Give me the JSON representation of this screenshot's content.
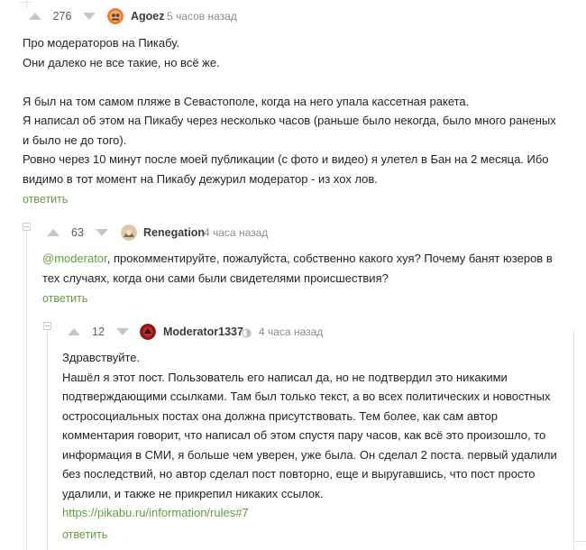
{
  "comments": [
    {
      "rating": "276",
      "author": "Agoez",
      "time": "5 часов назад",
      "lines": [
        "Про модераторов на Пикабу.",
        "Они далеко не все такие, но всё же.",
        "",
        "Я был на том самом пляже в Севастополе, когда на него упала кассетная ракета.",
        "Я написал об этом на Пикабу через несколько часов (раньше было некогда, было много раненых",
        "и было не до того).",
        "Ровно через 10 минут после моей публикации (с фото и видео) я улетел в Бан на 2 месяца. Ибо",
        "видимо в тот момент на Пикабу дежурил модератор - из хох лов."
      ],
      "reply_label": "ответить"
    },
    {
      "rating": "63",
      "author": "Renegation",
      "time": "4 часа назад",
      "mention": "@moderator",
      "line1_rest": ", прокомментируйте, пожалуйста, собственно какого хуя? Почему банят юзеров в",
      "line2": "тех случаях, когда они сами были свидетелями происшествия?",
      "reply_label": "ответить"
    },
    {
      "rating": "12",
      "author": "Moderator1337",
      "time": "4 часа назад",
      "lines": [
        "Здравствуйте.",
        "Нашёл я этот пост. Пользователь его написал да, но не подтвердил это никакими",
        "подтверждающими ссылками. Там был только текст, а во всех политических и новостных",
        "остросоциальных постах она должна присутствовать. Тем более, как сам автор",
        "комментария говорит, что написал об этом спустя пару часов, как всё это произошло, то",
        "информация в СМИ, я больше чем уверен, уже была. Он сделал 2 поста. первый удалили",
        "без последствий, но автор сделал пост повторно, еще и выругавшись, что пост просто",
        "удалили, и также не прикрепил никаких ссылок."
      ],
      "link": "https://pikabu.ru/information/rules#7",
      "reply_label": "ответить"
    }
  ],
  "colors": {
    "accent_green": "#5f9e3f",
    "vote_gray": "#c6c6c6",
    "thread_line": "#e4e4e4"
  },
  "icons": {
    "upvote": "triangle-up-icon",
    "downvote": "triangle-down-icon",
    "collapse": "minus-square-icon",
    "moderator_badge": "moderator-badge-icon"
  }
}
